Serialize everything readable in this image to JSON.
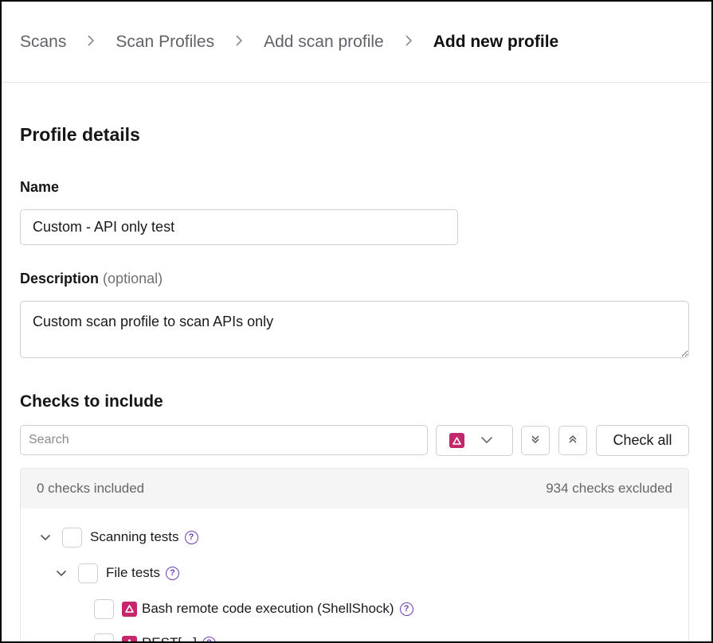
{
  "breadcrumb": {
    "items": [
      "Scans",
      "Scan Profiles",
      "Add scan profile"
    ],
    "current": "Add new profile",
    "separator": ">"
  },
  "profile": {
    "heading": "Profile details",
    "name_label": "Name",
    "name_value": "Custom - API only test",
    "description_label": "Description",
    "description_optional": "(optional)",
    "description_value": "Custom scan profile to scan APIs only"
  },
  "checks": {
    "heading": "Checks to include",
    "search_placeholder": "Search",
    "check_all_label": "Check all",
    "included_text": "0 checks included",
    "excluded_text": "934 checks excluded",
    "tree": [
      {
        "label": "Scanning tests",
        "level": 0,
        "expanded": true
      },
      {
        "label": "File tests",
        "level": 1,
        "expanded": true
      },
      {
        "label": "Bash remote code execution (ShellShock)",
        "level": 2,
        "severity": "high"
      },
      {
        "label": "REST[...]",
        "level": 2,
        "severity": "high"
      }
    ]
  },
  "colors": {
    "severity_high": "#c4276b",
    "help_icon": "#6b3fb8",
    "border": "#cfcfcf"
  },
  "icons": {
    "severity": "triangle-warning-icon",
    "dropdown": "chevron-down-icon",
    "expand_all": "double-chevron-down-icon",
    "collapse_all": "double-chevron-up-icon",
    "help": "question-circle-icon"
  }
}
